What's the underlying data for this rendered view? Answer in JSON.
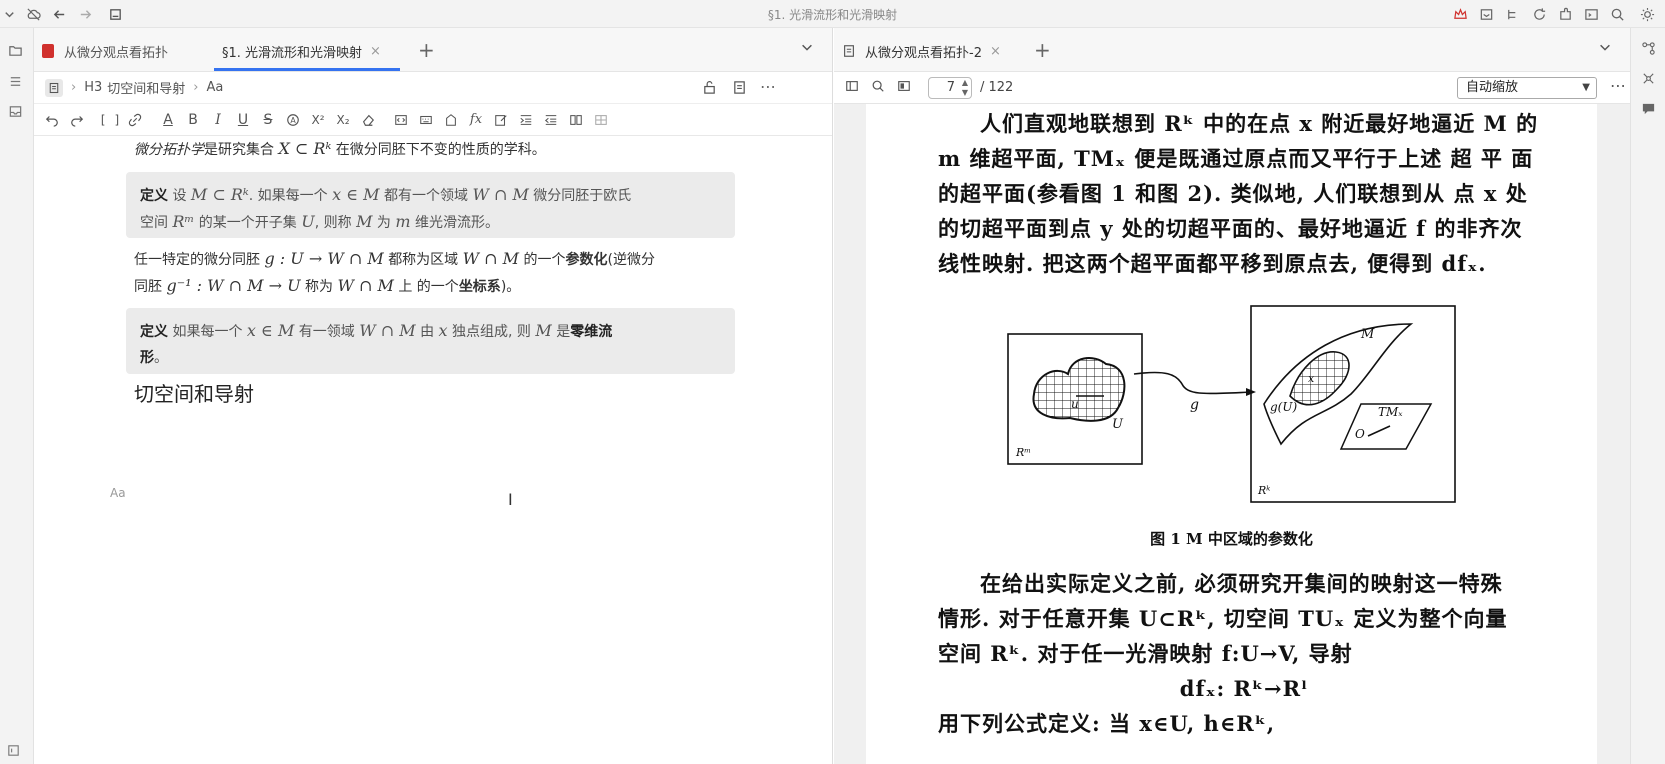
{
  "window": {
    "title": "§1. 光滑流形和光滑映射"
  },
  "left_pane": {
    "tabs": [
      {
        "label": "从微分观点看拓扑",
        "active": false
      },
      {
        "label": "§1. 光滑流形和光滑映射",
        "active": true,
        "close": "×"
      }
    ],
    "tab_add": "+",
    "breadcrumb": {
      "heading_tag": "H3",
      "heading": "切空间和导射",
      "leaf": "Aa"
    },
    "toolbar": {
      "bracket": "[ ]",
      "bold": "B",
      "italic": "I",
      "underline": "U",
      "strike": "S",
      "sup": "X²",
      "sub": "X₂",
      "formula": "fx"
    },
    "content": {
      "intro": "微分拓扑学是研究集合 X ⊂ Rᵏ 在微分同胚下不变的性质的学科。",
      "intro_em": "微分拓扑学",
      "intro_rest_a": "是研究集合",
      "intro_math": "X ⊂ Rᵏ",
      "intro_rest_b": "在微分同胚下不变的性质的学科。",
      "def1_label": "定义",
      "def1_line1_a": "设",
      "def1_line1_m1": "M ⊂ Rᵏ",
      "def1_line1_b": ". 如果每一个",
      "def1_line1_m2": "x ∈ M",
      "def1_line1_c": "都有一个领域",
      "def1_line1_m3": "W ∩ M",
      "def1_line1_d": "微分同胚于欧氏",
      "def1_line2_a": "空间",
      "def1_line2_m1": "Rᵐ",
      "def1_line2_b": "的某一个开子集",
      "def1_line2_m2": "U",
      "def1_line2_c": ", 则称",
      "def1_line2_m3": "M",
      "def1_line2_d": "为",
      "def1_line2_m4": "m",
      "def1_line2_e": "维光滑流形。",
      "para2_line1_a": "任一特定的微分同胚",
      "para2_line1_m1": "g : U → W ∩ M",
      "para2_line1_b": "都称为区域",
      "para2_line1_m2": "W ∩ M",
      "para2_line1_c": "的一个",
      "para2_line1_bold": "参数化",
      "para2_line1_d": "(逆微分",
      "para2_line2_a": "同胚",
      "para2_line2_m1": "g⁻¹ : W ∩ M → U",
      "para2_line2_b": "称为",
      "para2_line2_m2": "W ∩ M",
      "para2_line2_c": "上 的一个",
      "para2_line2_bold": "坐标系",
      "para2_line2_d": ")。",
      "def2_label": "定义",
      "def2_a": "如果每一个",
      "def2_m1": "x ∈ M",
      "def2_b": "有一领域",
      "def2_m2": "W ∩ M",
      "def2_c": "由",
      "def2_m3": "x",
      "def2_d": "独点组成, 则",
      "def2_m4": "M",
      "def2_e": "是",
      "def2_bold1": "零维流",
      "def2_bold2": "形",
      "def2_f": "。",
      "heading": "切空间和导射",
      "aa_hint": "Aa"
    }
  },
  "right_pane": {
    "tabs": [
      {
        "label": "从微分观点看拓扑-2",
        "close": "×"
      }
    ],
    "tab_add": "+",
    "page_current": "7",
    "page_total": "/ 122",
    "zoom": "自动缩放",
    "pdf": {
      "para1": [
        "人们直观地联想到 Rᵏ 中的在点 x 附近最好地逼近 M 的",
        "m 维超平面, TMₓ 便是既通过原点而又平行于上述 超 平 面",
        "的超平面(参看图 1 和图 2). 类似地, 人们联想到从 点 x 处",
        "的切超平面到点 y 处的切超平面的、最好地逼近 f 的非齐次",
        "线性映射. 把这两个超平面都平移到原点去, 便得到 dfₓ."
      ],
      "figure": {
        "left_label_u": "u",
        "left_label_U": "U",
        "left_space": "Rᵐ",
        "arrow_label": "g",
        "right_label_M": "M",
        "right_label_gU": "g(U)",
        "right_label_x": "x",
        "right_label_TM": "TMₓ",
        "right_label_O": "O",
        "right_space": "Rᵏ",
        "caption": "图 1   M 中区域的参数化"
      },
      "para2": [
        "在给出实际定义之前, 必须研究开集间的映射这一特殊",
        "情形. 对于任意开集 U⊂Rᵏ, 切空间 TUₓ 定义为整个向量",
        "空间 Rᵏ. 对于任一光滑映射 f:U→V, 导射",
        "dfₓ: Rᵏ→Rˡ",
        "用下列公式定义: 当 x∈U, h∈Rᵏ,"
      ]
    }
  }
}
